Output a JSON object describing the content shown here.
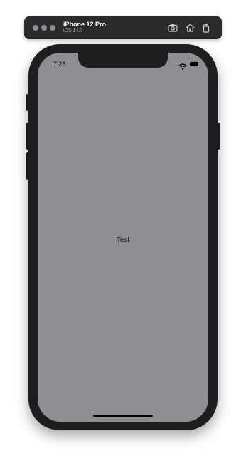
{
  "simulator": {
    "device_name": "iPhone 12 Pro",
    "os_version": "iOS 14.3",
    "toolbar_icons": [
      "screenshot-icon",
      "home-icon",
      "rotate-icon"
    ]
  },
  "status_bar": {
    "time": "7:23",
    "signal_dots": "·····",
    "icons": [
      "wifi-icon",
      "battery-icon"
    ]
  },
  "screen": {
    "background": "#8e8e93",
    "label": "Test"
  }
}
